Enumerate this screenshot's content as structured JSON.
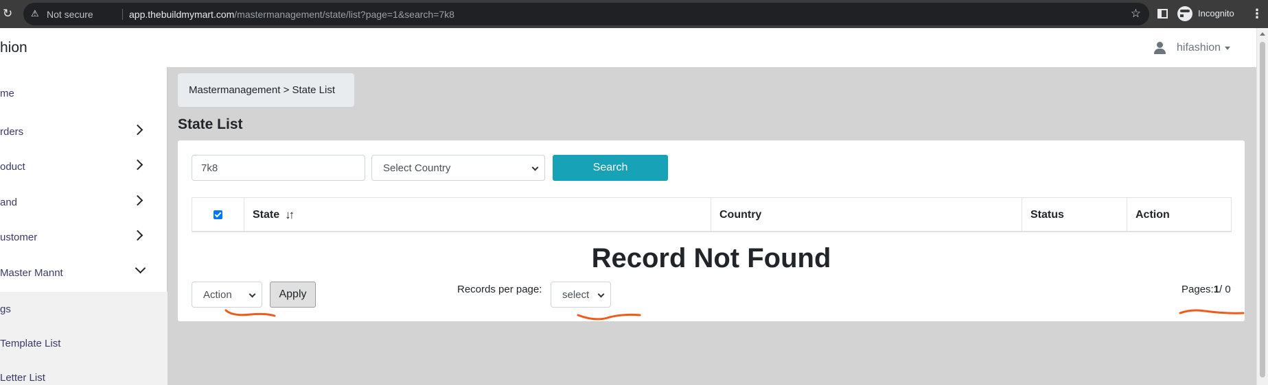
{
  "browser": {
    "security_label": "Not secure",
    "url_host": "app.thebuildmymart.com",
    "url_path": "/mastermanagement/state/list?page=1&search=7k8",
    "profile_label": "Incognito"
  },
  "header": {
    "brand": "hion",
    "user_name": "hifashion"
  },
  "sidebar": {
    "items": [
      {
        "label": "me"
      },
      {
        "label": "rders"
      },
      {
        "label": "oduct"
      },
      {
        "label": "and"
      },
      {
        "label": "ustomer"
      },
      {
        "label": "Master Mannt"
      },
      {
        "label": "gs"
      },
      {
        "label": "Template List"
      },
      {
        "label": "Letter List"
      }
    ]
  },
  "main": {
    "breadcrumb": "Mastermanagement > State List",
    "title": "State List",
    "filters": {
      "search_value": "7k8",
      "country_select": "Select Country",
      "search_button": "Search"
    },
    "table": {
      "columns": [
        "State",
        "Country",
        "Status",
        "Action"
      ],
      "sort_icon": "↓↑",
      "header_checked": true
    },
    "empty_message": "Record Not Found",
    "footer": {
      "action_select": "Action",
      "apply_button": "Apply",
      "records_label": "Records per page:",
      "records_select": "select",
      "pages_label": "Pages:",
      "pages_current": "1",
      "pages_total": "/ 0"
    }
  },
  "colors": {
    "primary_button": "#17a2b8",
    "annotation": "#f05a1a",
    "checkbox": "#0075ff"
  }
}
